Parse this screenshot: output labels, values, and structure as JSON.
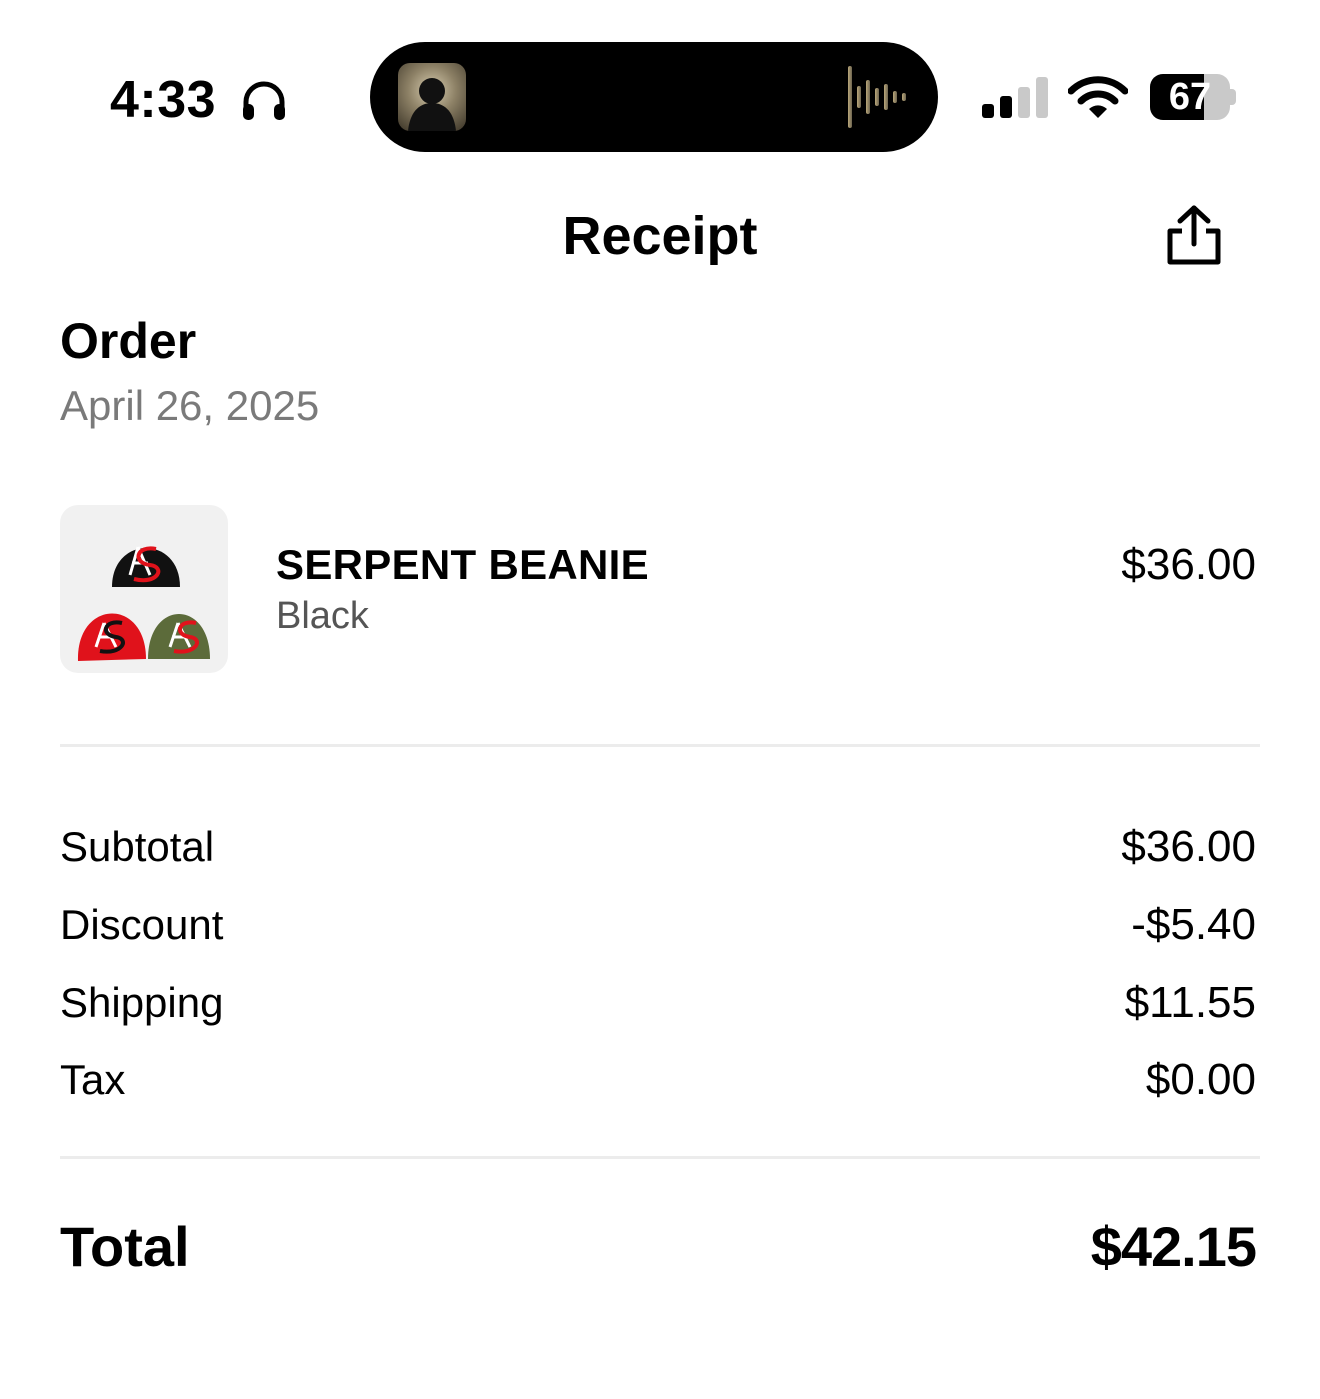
{
  "status_bar": {
    "time": "4:33",
    "battery_level": "67",
    "battery_fraction": 0.67
  },
  "nav": {
    "title": "Receipt",
    "share_icon": "share-icon"
  },
  "order": {
    "heading": "Order",
    "date": "April 26, 2025"
  },
  "item": {
    "name": "SERPENT BEANIE",
    "variant": "Black",
    "price": "$36.00",
    "beanie_colors": [
      "#111111",
      "#e0121b",
      "#5c6b3a"
    ]
  },
  "summary": {
    "subtotal_label": "Subtotal",
    "subtotal_value": "$36.00",
    "discount_label": "Discount",
    "discount_value": "-$5.40",
    "shipping_label": "Shipping",
    "shipping_value": "$11.55",
    "tax_label": "Tax",
    "tax_value": "$0.00"
  },
  "total": {
    "label": "Total",
    "value": "$42.15"
  }
}
